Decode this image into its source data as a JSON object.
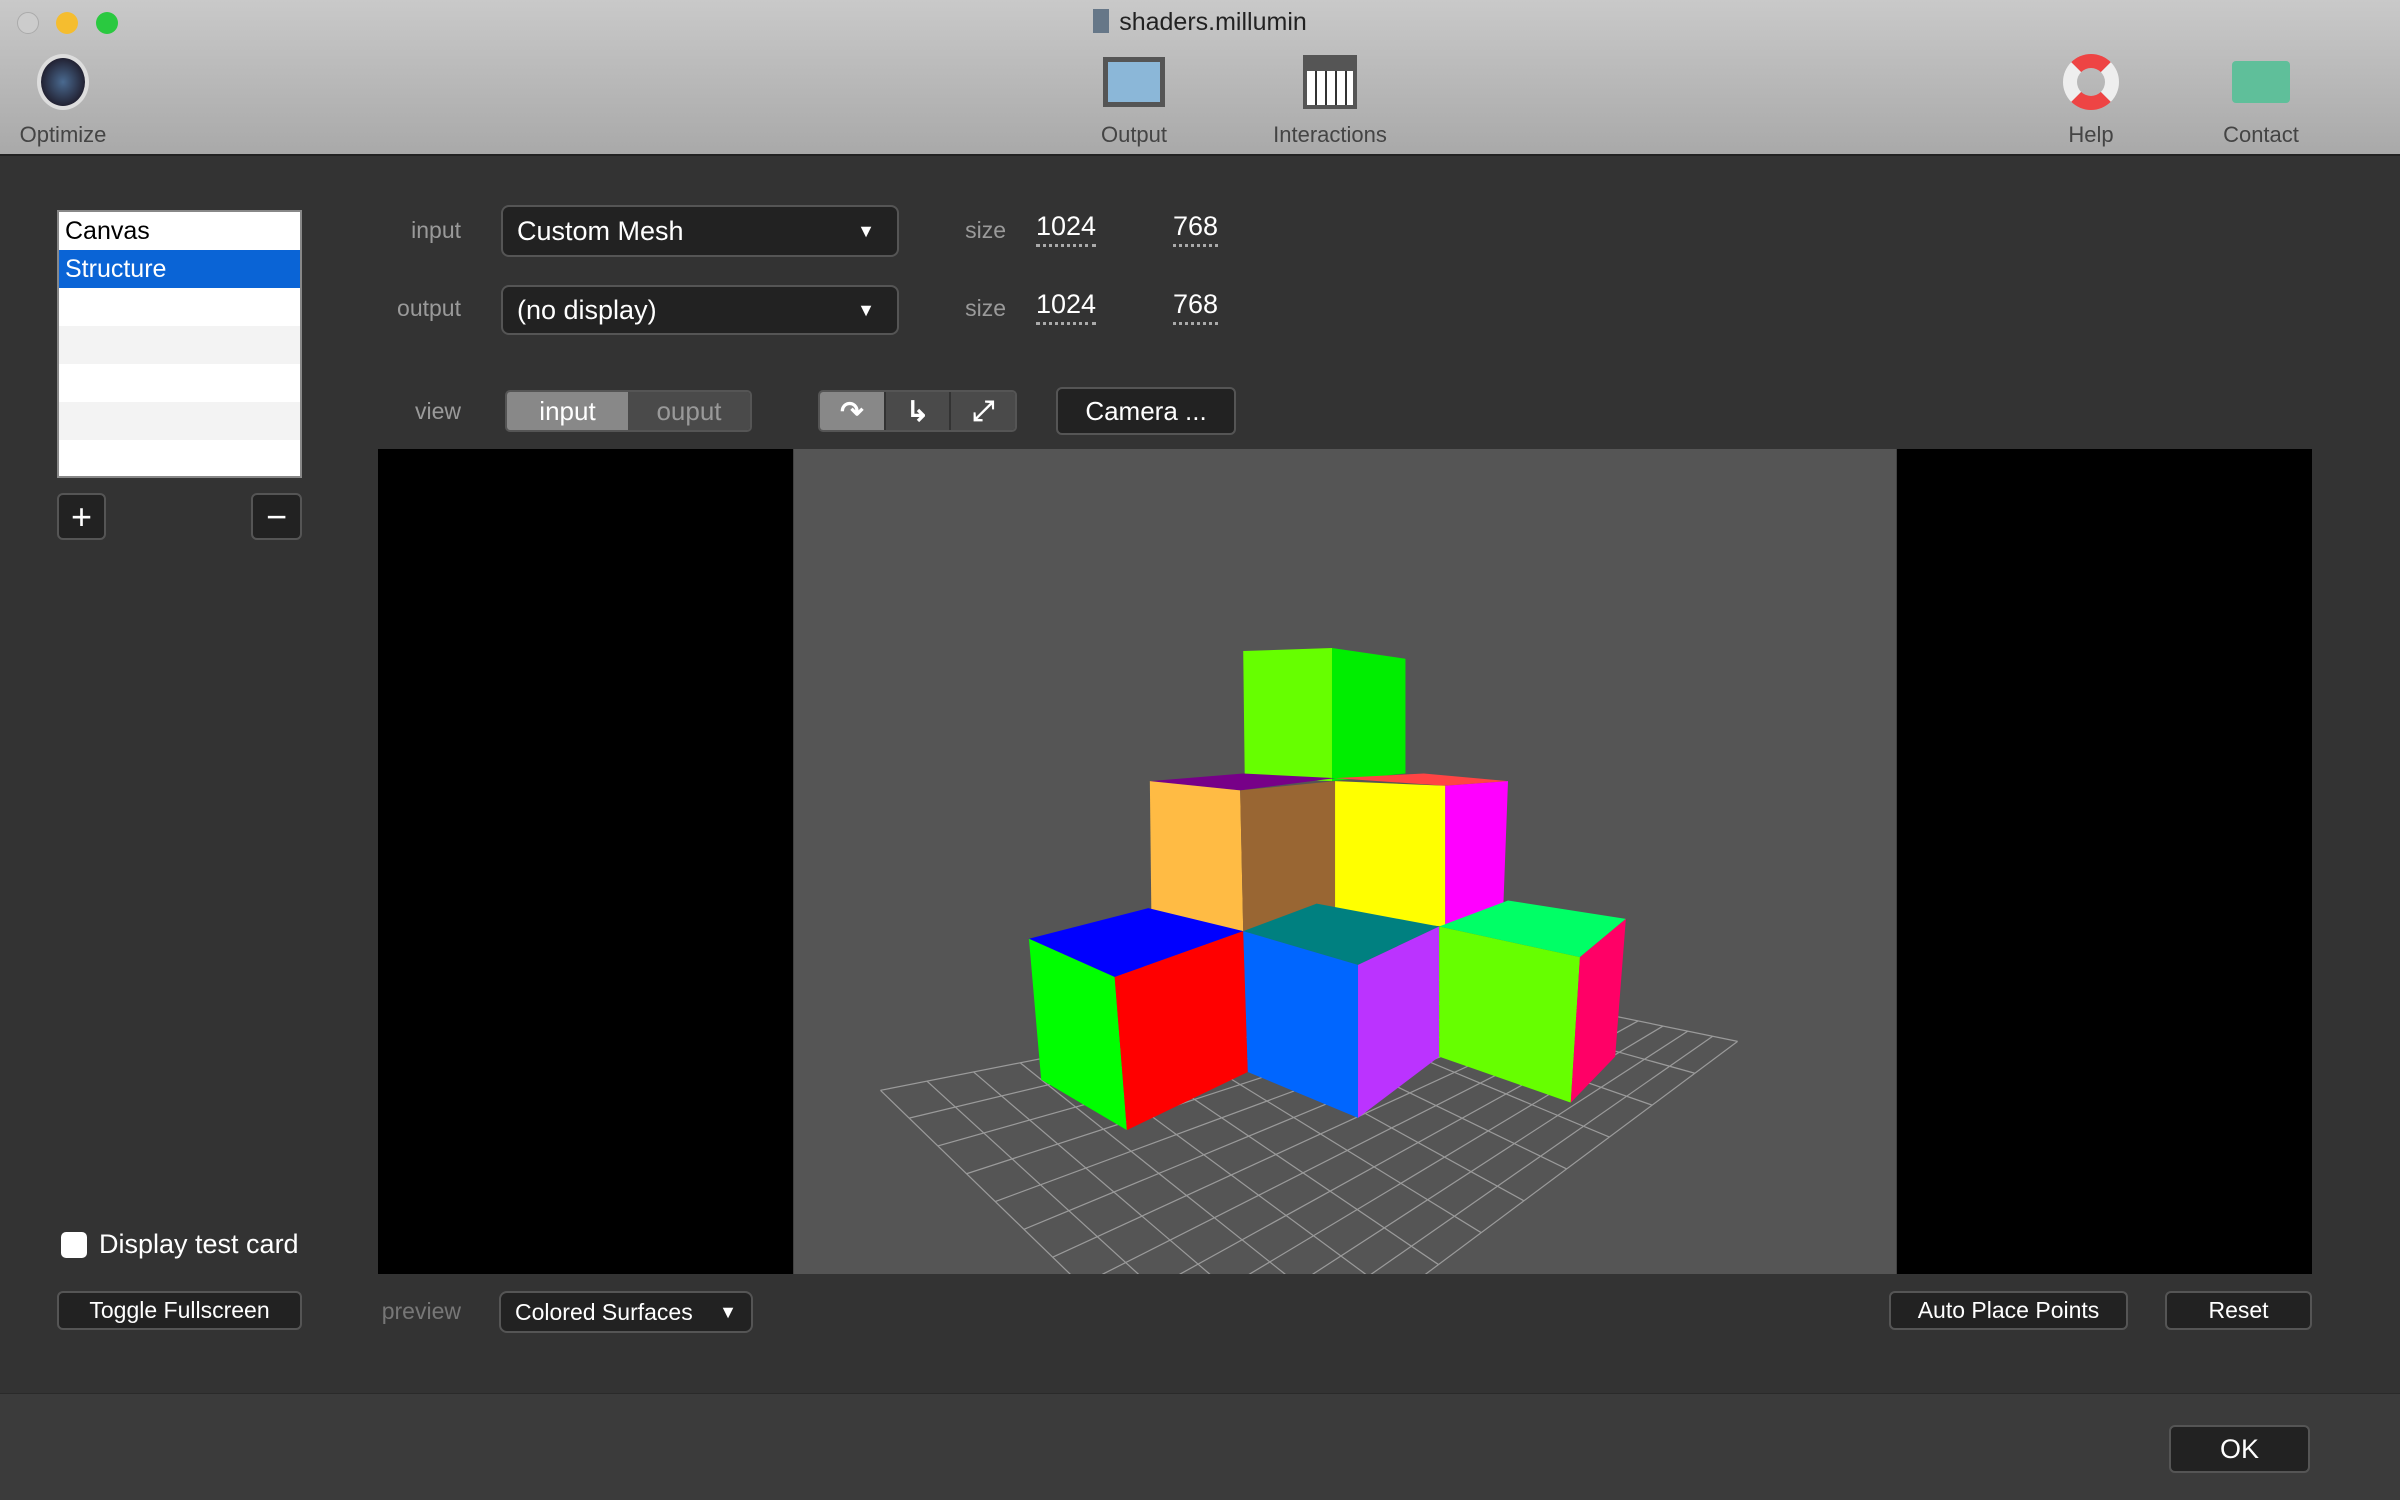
{
  "window": {
    "title": "shaders.millumin"
  },
  "toolbar": {
    "optimize": "Optimize",
    "output": "Output",
    "interactions": "Interactions",
    "help": "Help",
    "contact": "Contact"
  },
  "layers": {
    "items": [
      "Canvas",
      "Structure"
    ],
    "selected": "Structure",
    "add": "+",
    "remove": "−"
  },
  "form": {
    "input_label": "input",
    "input_value": "Custom Mesh",
    "output_label": "output",
    "output_value": "(no display)",
    "size_label": "size",
    "input_w": "1024",
    "input_h": "768",
    "output_w": "1024",
    "output_h": "768",
    "view_label": "view",
    "view_input": "input",
    "view_output": "ouput",
    "view_selected": "input",
    "camera": "Camera ..."
  },
  "left": {
    "test_card": "Display test card",
    "test_card_checked": false,
    "fullscreen": "Toggle Fullscreen"
  },
  "bottom": {
    "preview_label": "preview",
    "preview_value": "Colored Surfaces",
    "auto_place": "Auto Place Points",
    "reset": "Reset",
    "ok": "OK"
  },
  "colors": {
    "selection": "#0a64d6",
    "viewport_bg": "#555555"
  }
}
